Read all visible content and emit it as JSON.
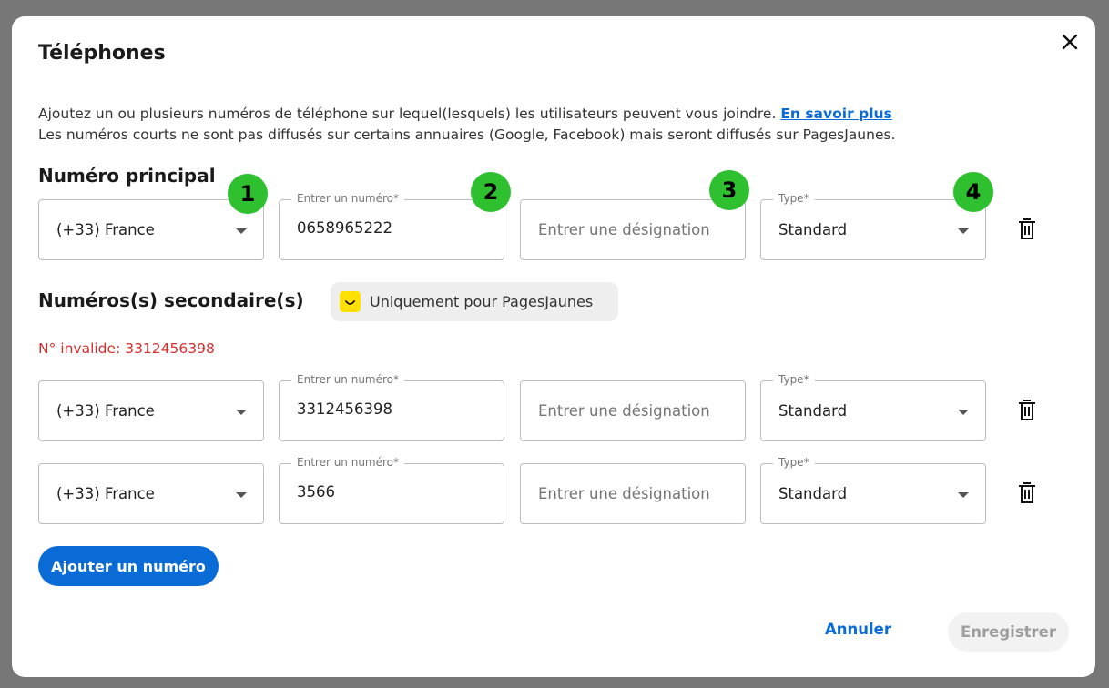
{
  "dialog": {
    "title": "Téléphones",
    "description_line1": "Ajoutez un ou plusieurs numéros de téléphone sur lequel(lesquels) les utilisateurs peuvent vous joindre.",
    "learn_more": "En savoir plus",
    "description_line2": "Les numéros courts ne sont pas diffusés sur certains annuaires (Google, Facebook) mais seront diffusés sur PagesJaunes."
  },
  "primary": {
    "heading": "Numéro principal",
    "country": "(+33) France",
    "number_label": "Entrer un numéro*",
    "number": "0658965222",
    "designation_placeholder": "Entrer une désignation",
    "type_label": "Type*",
    "type": "Standard"
  },
  "badges": [
    "1",
    "2",
    "3",
    "4"
  ],
  "secondary": {
    "heading": "Numéros(s) secondaire(s)",
    "chip_label": "Uniquement pour PagesJaunes",
    "error": "N° invalide: 3312456398",
    "rows": [
      {
        "country": "(+33) France",
        "number_label": "Entrer un numéro*",
        "number": "3312456398",
        "designation_placeholder": "Entrer une désignation",
        "type_label": "Type*",
        "type": "Standard"
      },
      {
        "country": "(+33) France",
        "number_label": "Entrer un numéro*",
        "number": "3566",
        "designation_placeholder": "Entrer une désignation",
        "type_label": "Type*",
        "type": "Standard"
      }
    ]
  },
  "actions": {
    "add": "Ajouter un numéro",
    "cancel": "Annuler",
    "save": "Enregistrer"
  },
  "colors": {
    "accent": "#0a6bd7",
    "badge": "#2ec02e",
    "error": "#d32f2f",
    "pagesjaunes_yellow": "#ffe000"
  }
}
